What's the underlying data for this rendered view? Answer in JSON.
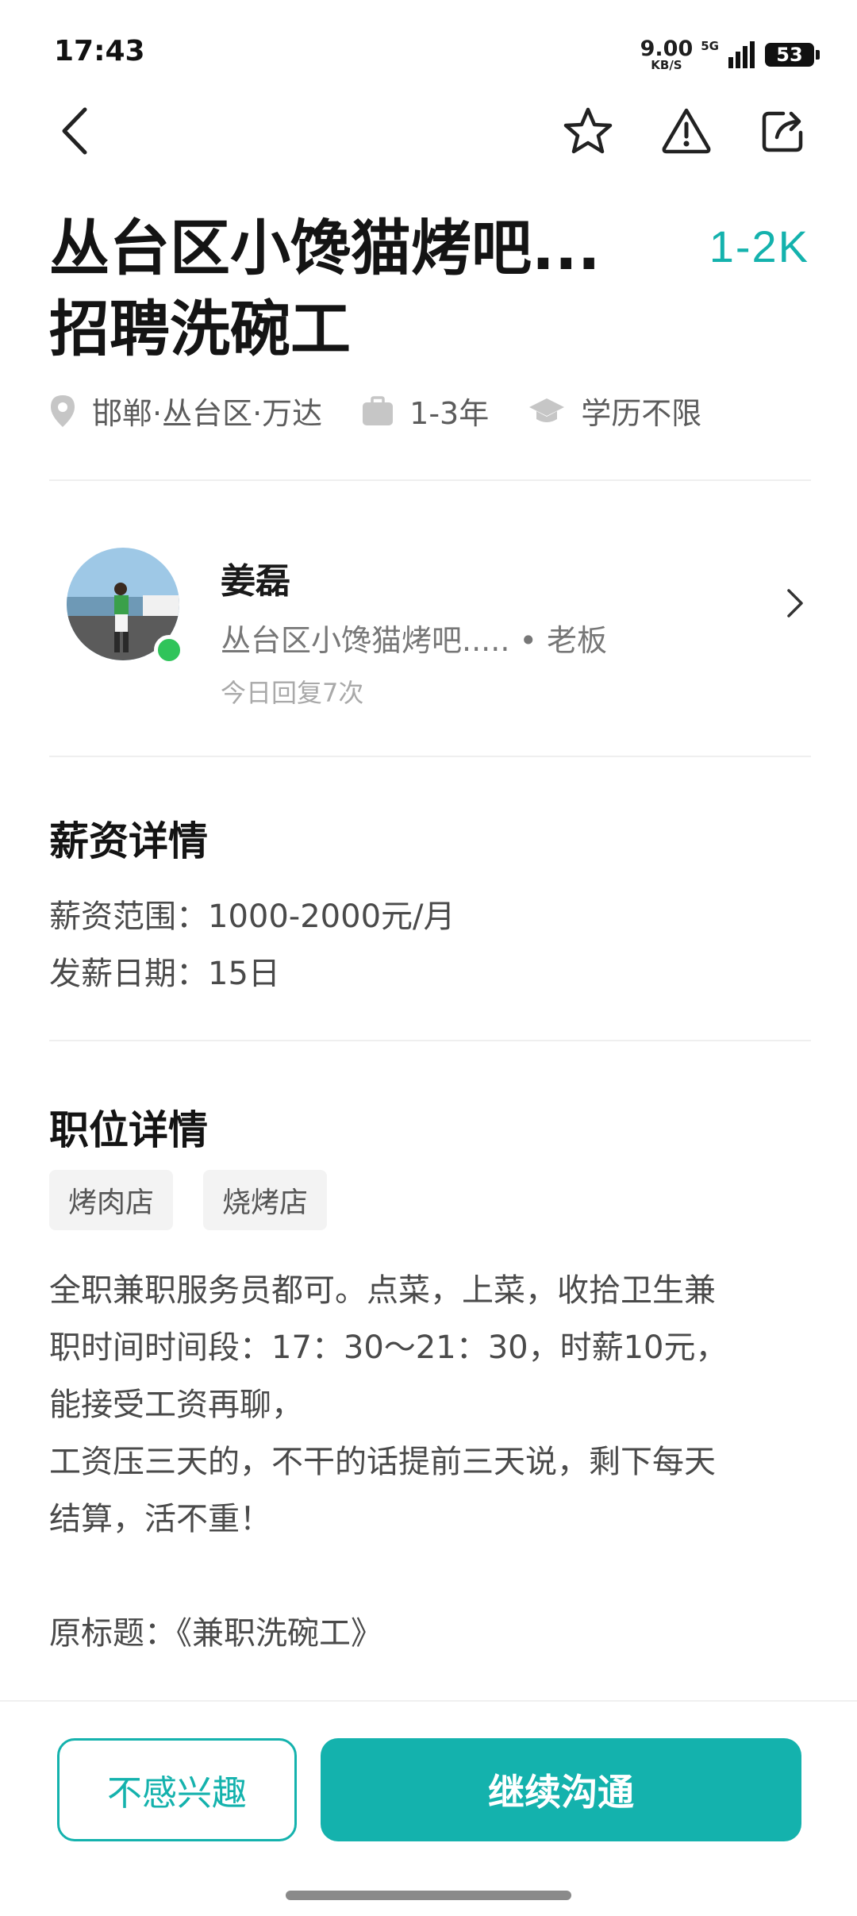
{
  "status_bar": {
    "time": "17:43",
    "net_speed": "9.00",
    "net_unit": "KB/S",
    "signal_label": "5G",
    "battery": "53"
  },
  "nav": {
    "back_icon": "chevron-left-icon",
    "favorite_icon": "star-icon",
    "report_icon": "warning-icon",
    "share_icon": "share-icon"
  },
  "job": {
    "title": "丛台区小馋猫烤吧...\n招聘洗碗工",
    "salary": "1-2K",
    "location": "邯郸·丛台区·万达",
    "experience": "1-3年",
    "education": "学历不限"
  },
  "boss": {
    "name": "姜磊",
    "company_role": "丛台区小馋猫烤吧..... • 老板",
    "reply_stat": "今日回复7次"
  },
  "salary_section": {
    "title": "薪资详情",
    "range": "薪资范围：1000-2000元/月",
    "payday": "发薪日期：15日"
  },
  "position_section": {
    "title": "职位详情",
    "tags": [
      "烤肉店",
      "烧烤店"
    ],
    "description": "全职兼职服务员都可。点菜，上菜，收拾卫生兼\n职时间时间段：17：30～21：30，时薪10元，\n能接受工资再聊，\n工资压三天的，不干的话提前三天说，剩下每天\n结算，活不重！\n\n原标题：《兼职洗碗工》"
  },
  "actions": {
    "not_interested": "不感兴趣",
    "continue_chat": "继续沟通"
  },
  "colors": {
    "accent": "#14b2ad",
    "online": "#2fc45a"
  }
}
